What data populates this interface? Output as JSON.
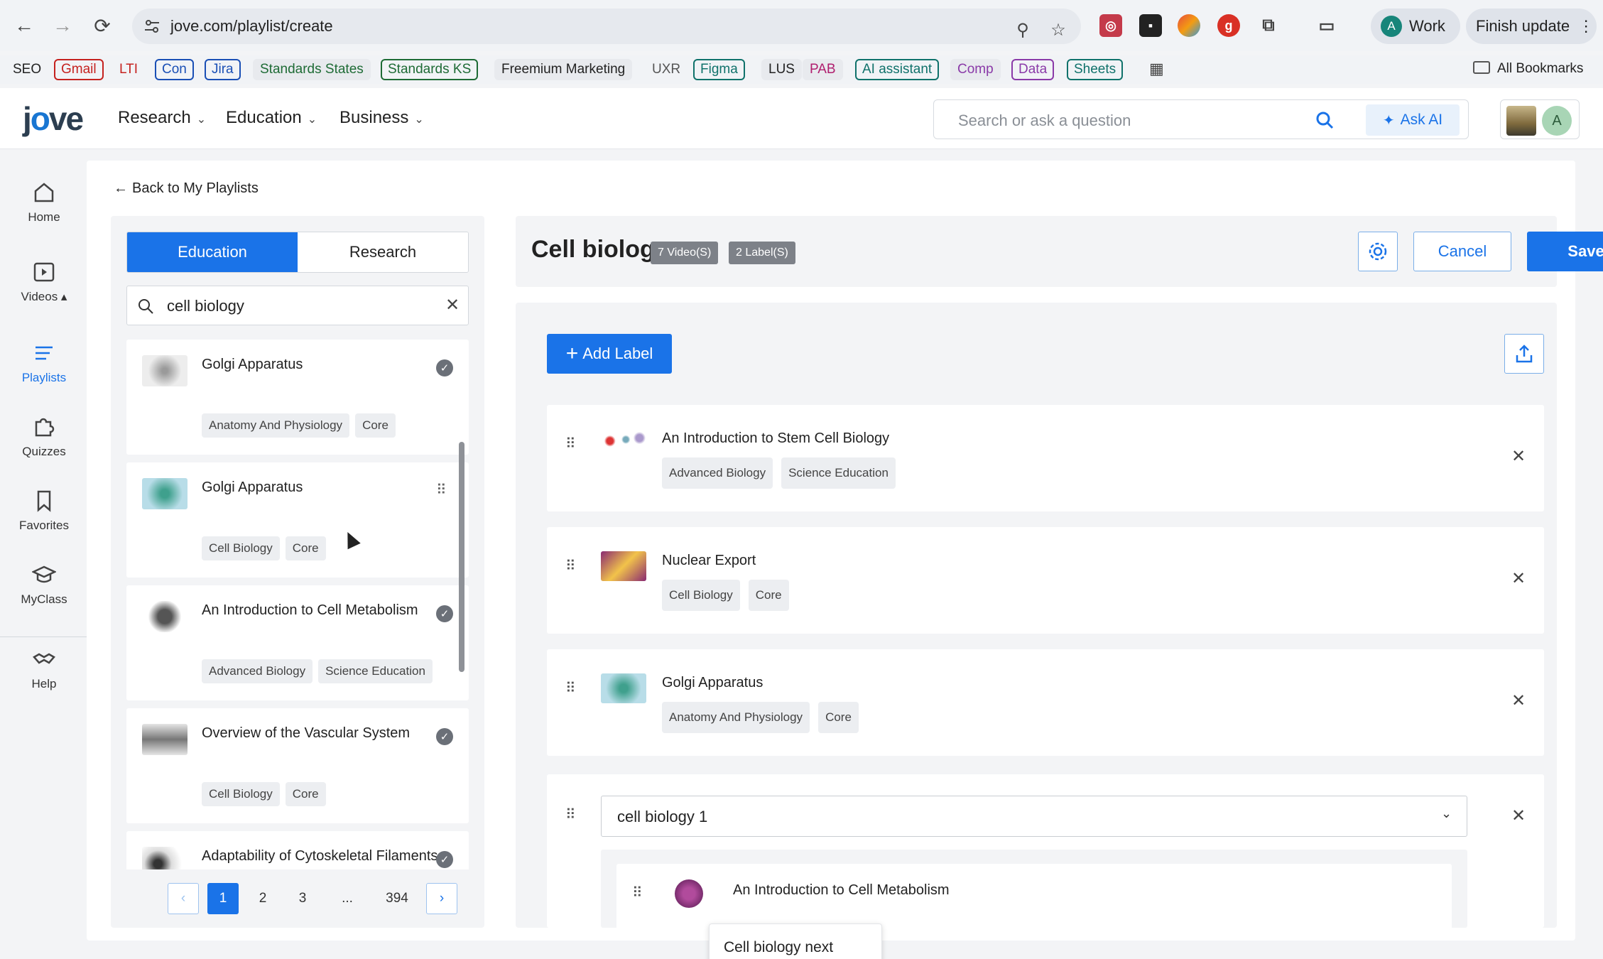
{
  "browser": {
    "url": "jove.com/playlist/create",
    "profile_label": "Work",
    "profile_initial": "A",
    "update_label": "Finish update"
  },
  "bookmarks": {
    "items": [
      {
        "label": "SEO",
        "color": "#222222",
        "outline": "none"
      },
      {
        "label": "Gmail",
        "color": "#c5221f",
        "outline": "#c5221f"
      },
      {
        "label": "LTI",
        "color": "#c5221f",
        "outline": "none"
      },
      {
        "label": "Con",
        "color": "#1a4fb5",
        "outline": "#1a4fb5"
      },
      {
        "label": "Jira",
        "color": "#1a4fb5",
        "outline": "#1a4fb5"
      },
      {
        "label": "Standards States",
        "color": "#1e6b35",
        "outline": "none"
      },
      {
        "label": "Standards KS",
        "color": "#1e6b35",
        "outline": "#1e6b35"
      },
      {
        "label": "Freemium Marketing",
        "color": "#222222",
        "outline": "none"
      },
      {
        "label": "UXR",
        "color": "#555555",
        "outline": "none"
      },
      {
        "label": "Figma",
        "color": "#10726b",
        "outline": "#10726b"
      },
      {
        "label": "LUS",
        "color": "#222222",
        "outline": "none"
      },
      {
        "label": "PAB",
        "color": "#b01e6e",
        "outline": "none"
      },
      {
        "label": "AI assistant",
        "color": "#10726b",
        "outline": "#10726b"
      },
      {
        "label": "Comp",
        "color": "#8a3aa8",
        "outline": "none"
      },
      {
        "label": "Data",
        "color": "#8a3aa8",
        "outline": "#8a3aa8"
      },
      {
        "label": "Sheets",
        "color": "#10726b",
        "outline": "#10726b"
      }
    ],
    "all_label": "All Bookmarks"
  },
  "header": {
    "nav": [
      "Research",
      "Education",
      "Business"
    ],
    "search_placeholder": "Search or ask a question",
    "ask_ai_label": "Ask AI",
    "avatar_initial": "A"
  },
  "rail": [
    {
      "label": "Home",
      "icon": "home-icon"
    },
    {
      "label": "Videos ▴",
      "icon": "video-icon"
    },
    {
      "label": "Playlists",
      "icon": "playlist-icon",
      "active": true
    },
    {
      "label": "Quizzes",
      "icon": "puzzle-icon"
    },
    {
      "label": "Favorites",
      "icon": "bookmark-icon"
    },
    {
      "label": "MyClass",
      "icon": "graduation-cap-icon"
    },
    {
      "label": "Help",
      "icon": "handshake-icon"
    }
  ],
  "back_link": "Back to My Playlists",
  "library": {
    "tabs": [
      "Education",
      "Research"
    ],
    "active_tab": "Education",
    "search_value": "cell biology",
    "results": [
      {
        "title": "Golgi Apparatus",
        "tags": [
          "Anatomy And Physiology",
          "Core"
        ],
        "state": "added"
      },
      {
        "title": "Golgi Apparatus",
        "tags": [
          "Cell Biology",
          "Core"
        ],
        "state": "drag"
      },
      {
        "title": "An Introduction to Cell Metabolism",
        "tags": [
          "Advanced Biology",
          "Science Education"
        ],
        "state": "added"
      },
      {
        "title": "Overview of the Vascular System",
        "tags": [
          "Cell Biology",
          "Core"
        ],
        "state": "added"
      },
      {
        "title": "Adaptability of Cytoskeletal Filaments",
        "tags": [],
        "state": "added"
      }
    ],
    "pagination": {
      "pages": [
        "1",
        "2",
        "3",
        "...",
        "394"
      ],
      "current": "1",
      "prev": "‹",
      "next": "›"
    }
  },
  "playlist": {
    "title": "Cell biology",
    "video_count": "7 Video(S)",
    "label_count": "2 Label(S)",
    "cancel_label": "Cancel",
    "save_label": "Save",
    "add_label": "Add Label",
    "items": [
      {
        "title": "An Introduction to Stem Cell Biology",
        "tags": [
          "Advanced Biology",
          "Science Education"
        ]
      },
      {
        "title": "Nuclear Export",
        "tags": [
          "Cell Biology",
          "Core"
        ]
      },
      {
        "title": "Golgi Apparatus",
        "tags": [
          "Anatomy And Physiology",
          "Core"
        ]
      }
    ],
    "label_group": {
      "selected": "cell biology 1",
      "nested_item_title": "An Introduction to Cell Metabolism"
    },
    "tooltip": "Cell biology next"
  }
}
